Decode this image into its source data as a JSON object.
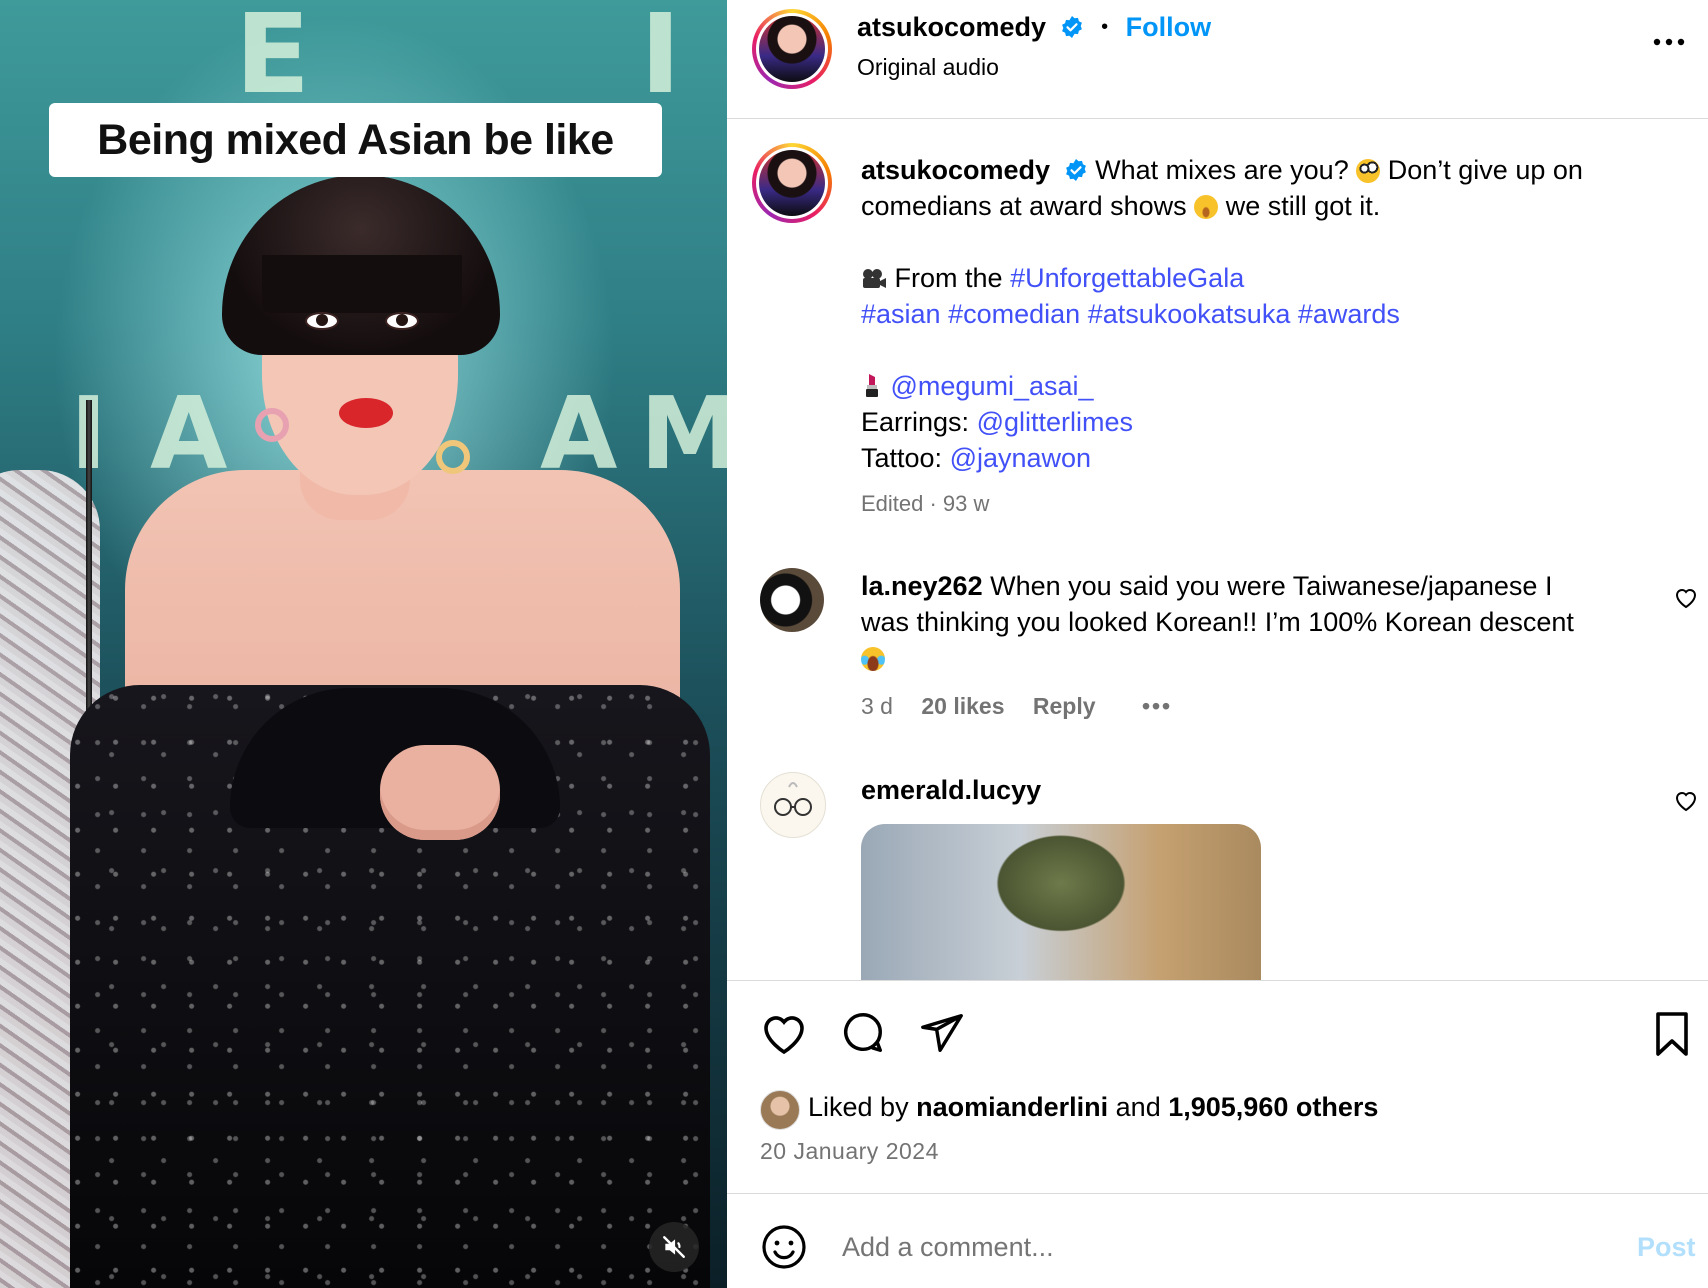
{
  "media": {
    "caption_overlay": "Being mixed Asian be like",
    "stage_letters_top": [
      "E",
      "I"
    ],
    "stage_letters_mid": [
      "I",
      "A",
      "A",
      "M"
    ]
  },
  "header": {
    "username": "atsukocomedy",
    "separator": "•",
    "follow_label": "Follow",
    "audio_label": "Original audio",
    "more_label": "•••"
  },
  "post": {
    "username": "atsukocomedy",
    "caption_part1": "What mixes are you?",
    "caption_part2": "Don’t give up on",
    "caption_line2a": "comedians at award shows",
    "caption_line2b": "we still got it.",
    "from_label": "From the",
    "hashtag_gala": "#UnforgettableGala",
    "hashtags": [
      "#asian",
      "#comedian",
      "#atsukookatsuka",
      "#awards"
    ],
    "makeup_handle": "@megumi_asai_",
    "earrings_label": "Earrings:",
    "earrings_handle": "@glitterlimes",
    "tattoo_label": "Tattoo:",
    "tattoo_handle": "@jaynawon",
    "meta": "Edited · 93 w"
  },
  "comments": [
    {
      "username": "la.ney262",
      "text_line1": "When you said you were Taiwanese/japanese I",
      "text_line2": "was thinking you looked Korean!! I’m 100% Korean descent",
      "age": "3 d",
      "likes": "20 likes",
      "reply_label": "Reply",
      "more_label": "•••"
    },
    {
      "username": "emerald.lucyy"
    }
  ],
  "actions": {
    "liked_by_prefix": "Liked by",
    "liked_by_user": "naomianderlini",
    "liked_by_and": "and",
    "liked_by_count": "1,905,960 others",
    "date": "20 January 2024"
  },
  "composer": {
    "placeholder": "Add a comment...",
    "post_label": "Post"
  },
  "colors": {
    "link": "#4150f7",
    "follow": "#0095f6",
    "muted": "#737373",
    "post_disabled": "#b2dffc",
    "divider": "#dbdbdb"
  },
  "icons": [
    "verified-badge-icon",
    "more-options-icon",
    "heart-icon",
    "comment-icon",
    "share-icon",
    "bookmark-icon",
    "emoji-icon",
    "mute-icon",
    "film-camera-icon",
    "lipstick-icon"
  ]
}
